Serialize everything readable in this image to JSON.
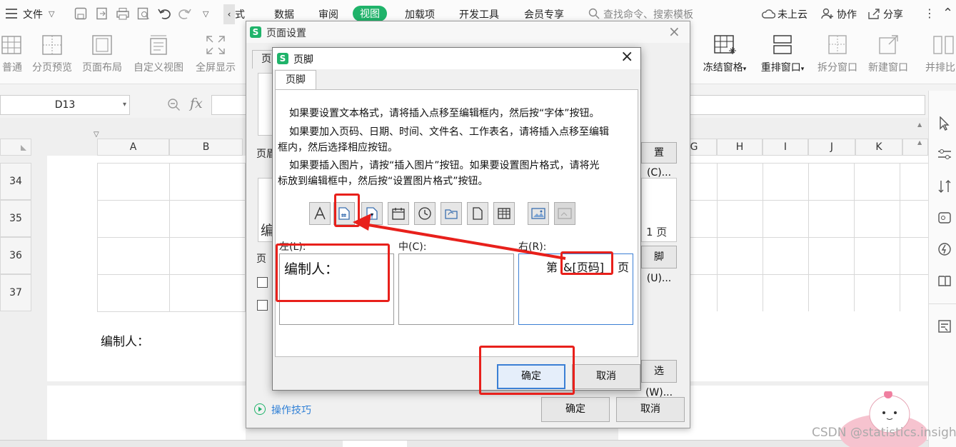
{
  "menubar": {
    "file_label": "文件",
    "tabs": [
      "式",
      "数据",
      "审阅",
      "视图",
      "加载项",
      "开发工具",
      "会员专享"
    ],
    "active_tab": "视图",
    "search_placeholder": "查找命令、搜索模板",
    "cloud_label": "未上云",
    "collab_label": "协作",
    "share_label": "分享"
  },
  "ribbon": {
    "left_buttons": [
      "普通",
      "分页预览",
      "页面布局",
      "自定义视图",
      "全屏显示"
    ],
    "right_buttons": [
      "冻结窗格",
      "重排窗口",
      "拆分窗口",
      "新建窗口",
      "并排比"
    ]
  },
  "formula": {
    "cell_ref": "D13",
    "fx": "fx"
  },
  "sheet": {
    "col_headers_left": [
      "A",
      "B"
    ],
    "col_headers_right": [
      "G",
      "H",
      "I",
      "J",
      "K"
    ],
    "row_numbers": [
      "34",
      "35",
      "36",
      "37"
    ],
    "footer_text": "编制人："
  },
  "page_setup": {
    "title": "页面设置",
    "tab_stub": "页",
    "header_stub": "页眉",
    "footer_stub": "页",
    "custom_header_btn": "置(C)...",
    "custom_footer_btn": "脚(U)...",
    "options_btn": "选(W)...",
    "preview_left": "编",
    "preview_right": "1 页",
    "tips": "操作技巧",
    "ok": "确定",
    "cancel": "取消"
  },
  "footer_dialog": {
    "title": "页脚",
    "tab": "页脚",
    "help1": "如果要设置文本格式，请将插入点移至编辑框内，然后按“字体”按钮。",
    "help2a": "如果要加入页码、日期、时间、文件名、工作表名，请将插入点移至编辑",
    "help2b": "框内，然后选择相应按钮。",
    "help3a": "如果要插入图片，请按“插入图片”按钮。如果要设置图片格式，请将光",
    "help3b": "标放到编辑框中，然后按“设置图片格式”按钮。",
    "left_label": "左(L):",
    "center_label": "中(C):",
    "right_label": "右(R):",
    "left_content": "编制人：",
    "right_prefix": "第",
    "right_field": "&[页码]",
    "right_suffix": "页",
    "ok": "确定",
    "cancel": "取消"
  },
  "status": {
    "sheet_tab": "",
    "watermark": "CSDN @statistics.insight"
  },
  "colors": {
    "accent": "#1fb36a",
    "highlight": "#e8201b",
    "focus": "#3b7fd4"
  }
}
